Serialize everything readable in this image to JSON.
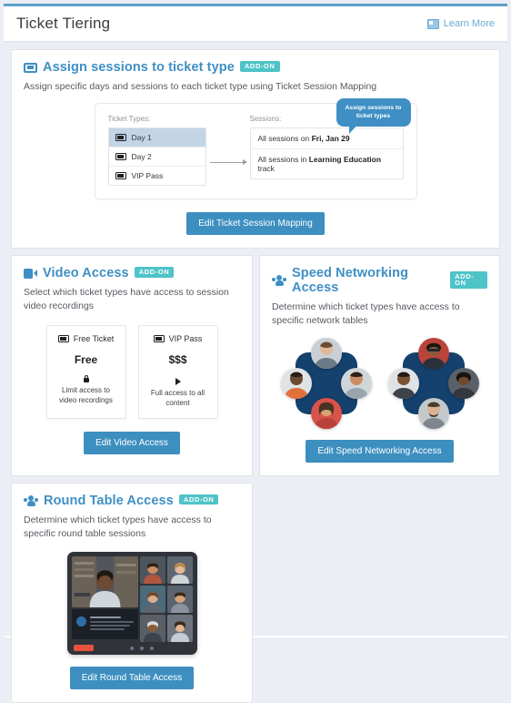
{
  "header": {
    "title": "Ticket Tiering",
    "learn_more": "Learn More",
    "learn_more_icon": "book-icon"
  },
  "accent_colors": {
    "title_blue": "#3f8fc4",
    "button_blue": "#3d8fc0",
    "badge_teal": "#4ec3c8",
    "table_navy": "#14416e",
    "page_bg": "#eceef5"
  },
  "cards": {
    "assign_sessions": {
      "icon": "ticket-icon",
      "title": "Assign sessions to ticket type",
      "badge": "ADD-ON",
      "description": "Assign specific days and sessions to each ticket type using Ticket Session Mapping",
      "diagram": {
        "ticket_types_label": "Ticket Types:",
        "ticket_types": [
          {
            "name": "Day 1",
            "selected": true
          },
          {
            "name": "Day 2",
            "selected": false
          },
          {
            "name": "VIP Pass",
            "selected": false
          }
        ],
        "sessions_label": "Sessions:",
        "sessions": [
          {
            "prefix": "All sessions on ",
            "bold": "Fri, Jan 29",
            "suffix": ""
          },
          {
            "prefix": "All sessions in ",
            "bold": "Learning Education",
            "suffix": " track"
          }
        ],
        "callout": "Assign sessions to ticket types"
      },
      "button": "Edit Ticket Session Mapping"
    },
    "video_access": {
      "icon": "video-camera-icon",
      "title": "Video Access",
      "badge": "ADD-ON",
      "description": "Select which ticket types have access to session video recordings",
      "tiers": [
        {
          "icon": "ticket-icon",
          "name": "Free Ticket",
          "price": "Free",
          "note_icon": "lock-icon",
          "note": "Limit access to video recordings"
        },
        {
          "icon": "ticket-icon",
          "name": "VIP Pass",
          "price": "$$$",
          "note_icon": "play-icon",
          "note": "Full access to all content"
        }
      ],
      "button": "Edit Video Access"
    },
    "speed_networking": {
      "icon": "people-group-icon",
      "title": "Speed Networking Access",
      "badge": "ADD-ON",
      "description": "Determine which ticket types have access to specific network tables",
      "tables": [
        {
          "seats": 4
        },
        {
          "seats": 4
        }
      ],
      "button": "Edit Speed Networking Access"
    },
    "round_table": {
      "icon": "people-group-icon",
      "title": "Round Table Access",
      "badge": "ADD-ON",
      "description": "Determine which ticket types have access to specific round table sessions",
      "preview": {
        "participants": 7,
        "leave_label": "",
        "dots": 3
      },
      "button": "Edit Round Table Access"
    }
  }
}
